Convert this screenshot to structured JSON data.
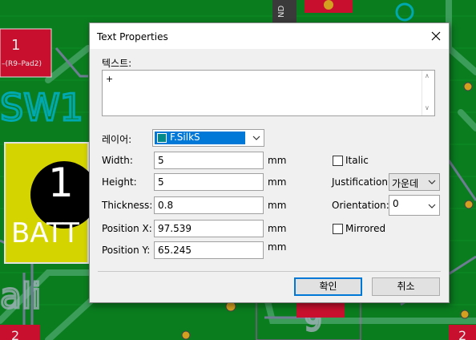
{
  "background": {
    "pad_number_top": "1",
    "pad_label_top": "–(R9–Pad2)",
    "silk_sw": "SW1",
    "battery_number": "1",
    "battery_label": "BATT",
    "net_label_top": "ND",
    "bottom_number": "2",
    "bottom_number_right": "2",
    "colors": {
      "board": "#0a7d1f",
      "track": "#32a852",
      "pad_red": "#c8102e",
      "pad_yellow": "#cccc00",
      "silk": "#00a8b0"
    }
  },
  "dialog": {
    "title": "Text Properties",
    "text_label": "텍스트:",
    "text_value": "+",
    "layer_label": "레이어:",
    "layer_value": "F.SilkS",
    "layer_color": "#008b8b",
    "fields": [
      {
        "label": "Width:",
        "value": "5",
        "unit": "mm"
      },
      {
        "label": "Height:",
        "value": "5",
        "unit": "mm"
      },
      {
        "label": "Thickness:",
        "value": "0.8",
        "unit": "mm"
      },
      {
        "label": "Position X:",
        "value": "97.539",
        "unit": "mm"
      },
      {
        "label": "Position Y:",
        "value": "65.245",
        "unit": "mm"
      }
    ],
    "italic_label": "Italic",
    "italic_checked": false,
    "justification_label": "Justification:",
    "justification_value": "가운데",
    "orientation_label": "Orientation:",
    "orientation_value": "0",
    "mirrored_label": "Mirrored",
    "mirrored_checked": false,
    "ok_label": "확인",
    "cancel_label": "취소"
  }
}
